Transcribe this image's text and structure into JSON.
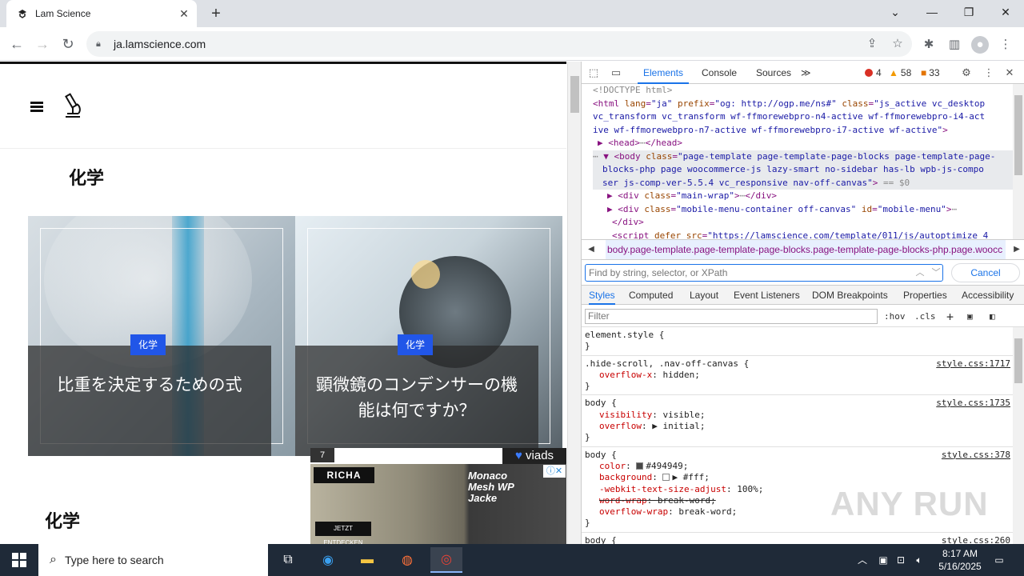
{
  "browser": {
    "tab_title": "Lam Science",
    "tab_close": "✕",
    "new_tab": "+",
    "url": "ja.lamscience.com",
    "window_controls": {
      "minimize": "—",
      "restore": "❐",
      "close": "✕",
      "tablist": "⌄"
    }
  },
  "page": {
    "category_heading_1": "化学",
    "category_heading_2": "化学",
    "cards": [
      {
        "badge": "化学",
        "title": "比重を決定するための式"
      },
      {
        "badge": "化学",
        "title": "顕微鏡のコンデンサーの機能は何ですか？"
      }
    ],
    "ad": {
      "number": "7",
      "network": "viads",
      "brand": "RICHA",
      "cta": "JETZT ENTDECKEN",
      "product": "Monaco Mesh WP Jacke"
    }
  },
  "devtools": {
    "tabs": [
      "Elements",
      "Console",
      "Sources"
    ],
    "active_tab": "Elements",
    "more_tabs": "≫",
    "errors": "4",
    "warnings": "58",
    "issues": "33",
    "dom_lines": [
      {
        "indent": 0,
        "html": "<span class='grey'>&lt;!DOCTYPE html&gt;</span>"
      },
      {
        "indent": 0,
        "html": "&lt;<span class='tagn'>html</span> <span class='attrn'>lang</span>=<span class='attrv'>\"ja\"</span> <span class='attrn'>prefix</span>=<span class='attrv'>\"og: http://ogp.me/ns#\"</span> <span class='attrn'>class</span>=<span class='attrv'>\"js_active vc_desktop</span>"
      },
      {
        "indent": 0,
        "html": "<span class='attrv'>vc_transform vc_transform wf-ffmorewebpro-n4-active wf-ffmorewebpro-i4-act</span>"
      },
      {
        "indent": 0,
        "html": "<span class='attrv'>ive wf-ffmorewebpro-n7-active wf-ffmorewebpro-i7-active wf-active\"</span>&gt;"
      },
      {
        "indent": 1,
        "html": "▶ &lt;<span class='tagn'>head</span>&gt;<span class='grey'>⋯</span>&lt;/<span class='tagn'>head</span>&gt;"
      },
      {
        "indent": 0,
        "html": "<span class='grey'>⋯</span> ▼ &lt;<span class='tagn'>body</span> <span class='attrn'>class</span>=<span class='attrv'>\"page-template page-template-page-blocks page-template-page-</span>"
      },
      {
        "indent": 2,
        "html": "<span class='attrv'>blocks-php page woocommerce-js lazy-smart no-sidebar has-lb wpb-js-compo</span>"
      },
      {
        "indent": 2,
        "html": "<span class='attrv'>ser js-comp-ver-5.5.4 vc_responsive nav-off-canvas\"</span>&gt; <span class='grey'>== $0</span>"
      },
      {
        "indent": 3,
        "html": "▶ &lt;<span class='tagn'>div</span> <span class='attrn'>class</span>=<span class='attrv'>\"main-wrap\"</span>&gt;<span class='grey'>⋯</span>&lt;/<span class='tagn'>div</span>&gt;"
      },
      {
        "indent": 3,
        "html": "▶ &lt;<span class='tagn'>div</span> <span class='attrn'>class</span>=<span class='attrv'>\"mobile-menu-container off-canvas\"</span> <span class='attrn'>id</span>=<span class='attrv'>\"mobile-menu\"</span>&gt;<span class='grey'>⋯</span>"
      },
      {
        "indent": 4,
        "html": "&lt;/<span class='tagn'>div</span>&gt;"
      },
      {
        "indent": 4,
        "html": "&lt;<span class='tagn'>script</span> <span class='attrn'>defer</span> <span class='attrn'>src</span>=<span class='attrv'>\"https://lamscience.com/template/011/js/autoptimize_4</span>"
      }
    ],
    "breadcrumb": "body.page-template.page-template-page-blocks.page-template-page-blocks-php.page.woocc",
    "find_placeholder": "Find by string, selector, or XPath",
    "cancel_label": "Cancel",
    "subtabs": [
      "Styles",
      "Computed",
      "Layout",
      "Event Listeners",
      "DOM Breakpoints",
      "Properties",
      "Accessibility"
    ],
    "filter_placeholder": "Filter",
    "hov": ":hov",
    "cls": ".cls",
    "rules": [
      {
        "selector": "element.style {",
        "source": "",
        "props": [],
        "close": "}"
      },
      {
        "selector": ".hide-scroll, .nav-off-canvas {",
        "source": "style.css:1717",
        "props": [
          {
            "n": "overflow-x",
            "v": "hidden;",
            "strike": false
          }
        ],
        "close": "}"
      },
      {
        "selector": "body {",
        "source": "style.css:1735",
        "props": [
          {
            "n": "visibility",
            "v": "visible;",
            "strike": false
          },
          {
            "n": "overflow",
            "v": "▶ initial;",
            "strike": false
          }
        ],
        "close": "}"
      },
      {
        "selector": "body {",
        "source": "style.css:378",
        "props": [
          {
            "n": "color",
            "v": "#494949;",
            "strike": false,
            "swatch": "#494949"
          },
          {
            "n": "background",
            "v": "▶ #fff;",
            "strike": false,
            "swatch": "#ffffff"
          },
          {
            "n": "-webkit-text-size-adjust",
            "v": "100%;",
            "strike": false
          },
          {
            "n": "word-wrap",
            "v": "break-word;",
            "strike": true
          },
          {
            "n": "overflow-wrap",
            "v": "break-word;",
            "strike": false
          }
        ],
        "close": "}"
      },
      {
        "selector": "body {",
        "source": "style.css:260",
        "props": [],
        "close": ""
      }
    ]
  },
  "watermark": "ANY RUN",
  "taskbar": {
    "search_placeholder": "Type here to search",
    "time": "8:17 AM",
    "date": "5/16/2025"
  }
}
